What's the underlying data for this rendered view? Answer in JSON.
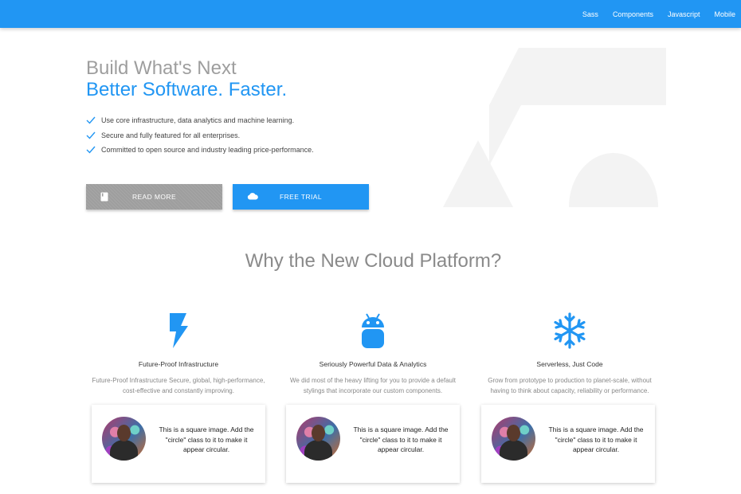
{
  "nav": {
    "items": [
      "Sass",
      "Components",
      "Javascript",
      "Mobile"
    ]
  },
  "hero": {
    "title": "Build What's Next",
    "subtitle": "Better Software. Faster.",
    "features": [
      "Use core infrastructure, data analytics and machine learning.",
      "Secure and fully featured for all enterprises.",
      "Committed to open source and industry leading price-performance."
    ],
    "read_more_label": "READ MORE",
    "free_trial_label": "FREE TRIAL"
  },
  "section": {
    "title": "Why the New Cloud Platform?",
    "columns": [
      {
        "icon": "flash-icon",
        "title": "Future-Proof Infrastructure",
        "description": "Future-Proof Infrastructure Secure, global, high-performance, cost-effective and constantly improving."
      },
      {
        "icon": "android-icon",
        "title": "Seriously Powerful Data & Analytics",
        "description": "We did most of the heavy lifting for you to provide a default stylings that incorporate our custom components."
      },
      {
        "icon": "snowflake-icon",
        "title": "Serverless, Just Code",
        "description": "Grow from prototype to production to planet-scale, without having to think about capacity, reliability or performance."
      }
    ],
    "cards": [
      {
        "text": "This is a square image. Add the \"circle\" class to it to make it appear circular."
      },
      {
        "text": "This is a square image. Add the \"circle\" class to it to make it appear circular."
      },
      {
        "text": "This is a square image. Add the \"circle\" class to it to make it appear circular."
      }
    ]
  },
  "colors": {
    "primary": "#2196f3",
    "grey_button": "#9e9e9e",
    "hero_title": "#9e9e9e",
    "background_shape": "#f3f3f3"
  }
}
